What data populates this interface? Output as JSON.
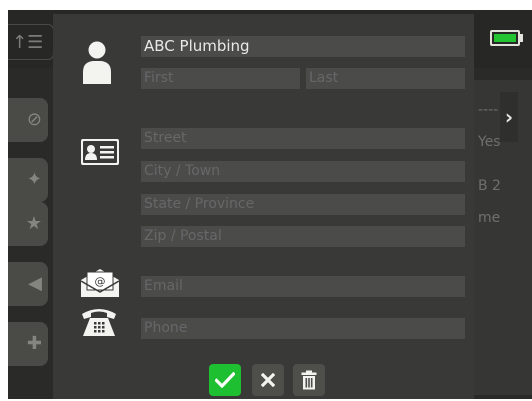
{
  "background": {
    "right_items": [
      "Yes",
      "B 2",
      "me"
    ],
    "right_dash": "----"
  },
  "form": {
    "company": {
      "value": "ABC Plumbing"
    },
    "first": {
      "placeholder": "First"
    },
    "last": {
      "placeholder": "Last"
    },
    "street": {
      "placeholder": "Street"
    },
    "city": {
      "placeholder": "City / Town"
    },
    "state": {
      "placeholder": "State / Province"
    },
    "zip": {
      "placeholder": "Zip / Postal"
    },
    "email": {
      "placeholder": "Email"
    },
    "phone": {
      "placeholder": "Phone"
    }
  },
  "icons": {
    "person": "person-icon",
    "address": "address-card-icon",
    "email": "email-envelope-icon",
    "phone": "telephone-icon",
    "ok": "checkmark-icon",
    "cancel": "close-icon",
    "delete": "trash-icon",
    "battery": "battery-icon",
    "chevron": "chevron-right-icon"
  },
  "colors": {
    "confirm": "#1fbf32",
    "battery": "#22c531",
    "modal_bg": "#393938",
    "field_bg": "#4b4b49"
  },
  "battery_level": 0.85
}
